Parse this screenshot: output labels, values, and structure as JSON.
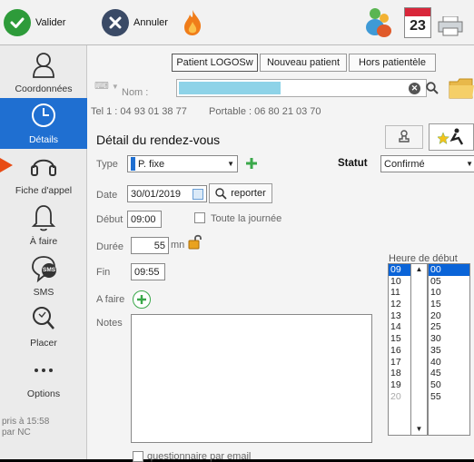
{
  "toolbar": {
    "validate_label": "Valider",
    "cancel_label": "Annuler",
    "calendar_day": "23"
  },
  "sidebar": {
    "items": [
      {
        "label": "Coordonnées"
      },
      {
        "label": "Détails"
      },
      {
        "label": "Fiche d'appel"
      },
      {
        "label": "À faire"
      },
      {
        "label": "SMS"
      },
      {
        "label": "Placer"
      },
      {
        "label": "Options"
      }
    ],
    "footer": "pris à 15:58\npar NC",
    "sms_badge": "SMS"
  },
  "patient_tabs": [
    "Patient LOGOSw",
    "Nouveau patient",
    "Hors patientèle"
  ],
  "search": {
    "label": "Nom :",
    "value": ""
  },
  "contact": {
    "tel": "Tel 1 : 04 93 01 38 77",
    "mobile": "Portable : 06 80 21 03 70"
  },
  "details": {
    "title": "Détail du rendez-vous",
    "type_label": "Type",
    "type_value": "P. fixe",
    "status_label": "Statut",
    "status_value": "Confirmé",
    "date_label": "Date",
    "date_value": "30/01/2019",
    "report_label": "reporter",
    "start_label": "Début",
    "start_value": "09:00",
    "allday_label": "Toute la journée",
    "duration_label": "Durée",
    "duration_value": "55",
    "duration_unit": "mn",
    "end_label": "Fin",
    "end_value": "09:55",
    "todo_label": "A faire",
    "notes_label": "Notes",
    "questionnaire_label": "questionnaire par email"
  },
  "start_time": {
    "label": "Heure de début",
    "hours": [
      "09",
      "10",
      "11",
      "12",
      "13",
      "14",
      "15",
      "16",
      "17",
      "18",
      "19",
      "20"
    ],
    "minutes": [
      "00",
      "05",
      "10",
      "15",
      "20",
      "25",
      "30",
      "35",
      "40",
      "45",
      "50",
      "55"
    ],
    "selected_hour": "09",
    "selected_minute": "00"
  },
  "colors": {
    "accent": "#1f6fd1",
    "highlight": "#0a64d8",
    "search_fill": "#8ed3e8",
    "validate": "#2e9b3a",
    "cancel": "#3a4a66"
  }
}
